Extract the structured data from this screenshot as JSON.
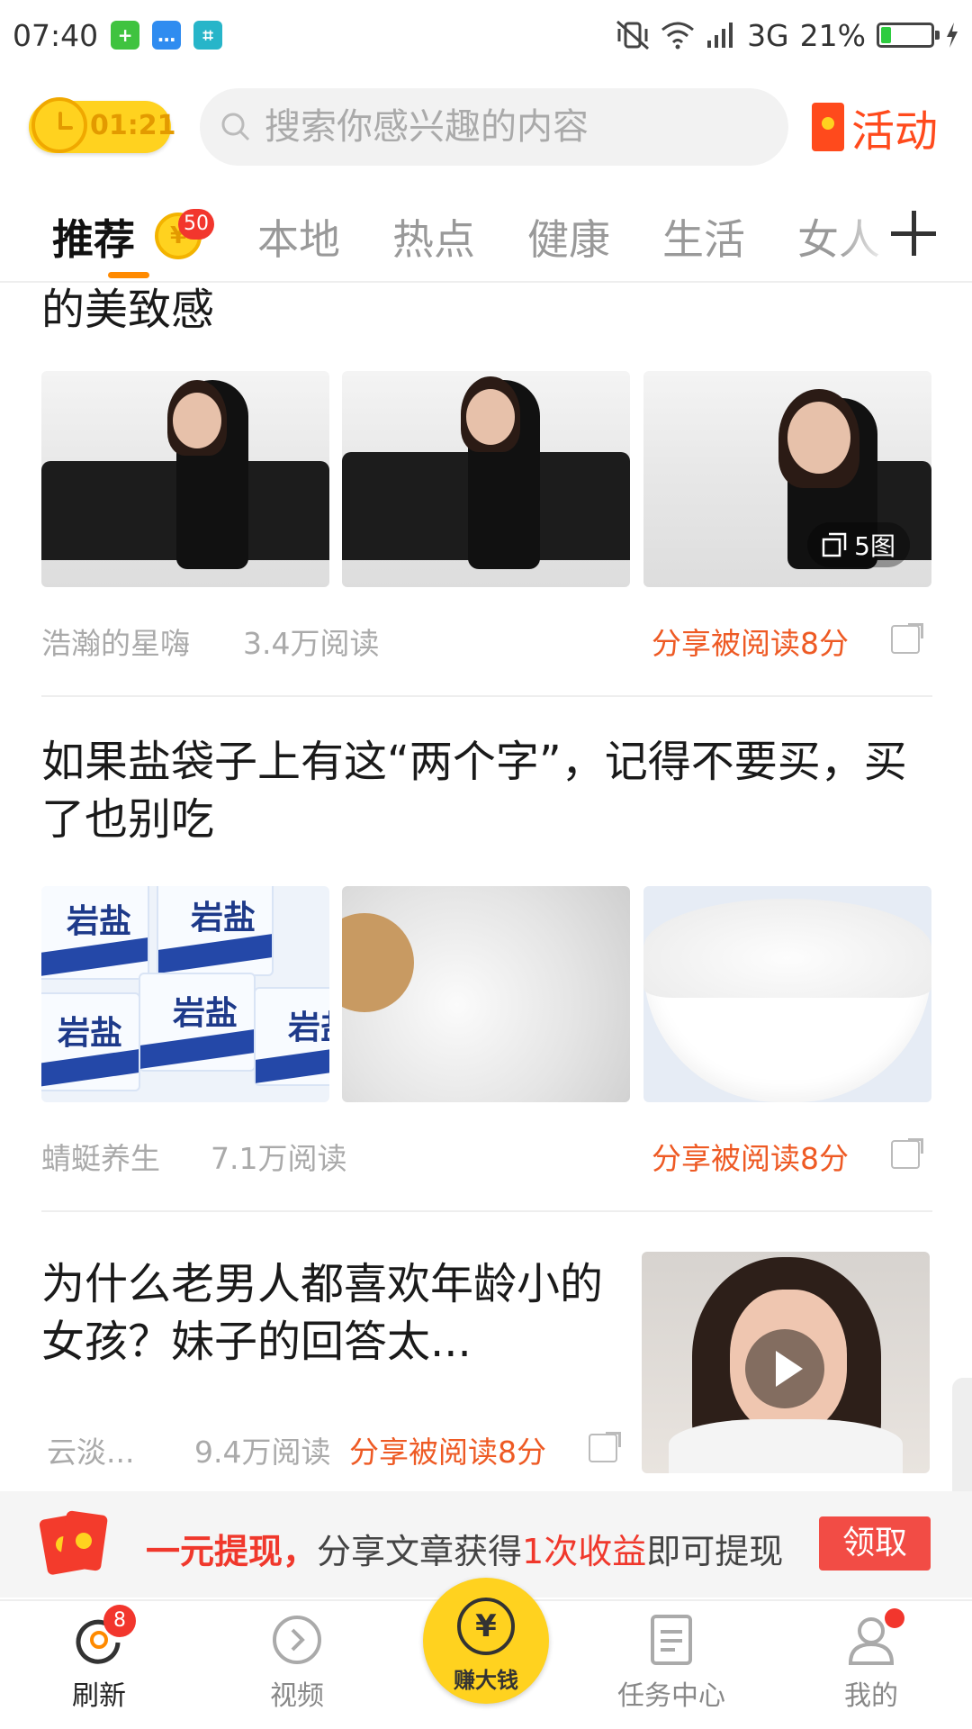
{
  "status_bar": {
    "time": "07:40",
    "network": "3G",
    "battery": "21%",
    "battery_level": 0.21,
    "icons": [
      "app-plus-icon",
      "message-icon",
      "scan-icon",
      "vibrate-icon",
      "wifi-icon",
      "signal-icon",
      "battery-icon"
    ]
  },
  "header": {
    "timer": "01:21",
    "search_placeholder": "搜索你感兴趣的内容",
    "activity_label": "活动"
  },
  "tabs": {
    "items": [
      "推荐",
      "本地",
      "热点",
      "健康",
      "生活",
      "女人"
    ],
    "active_index": 0,
    "coin_badge": "50",
    "coin_symbol": "¥"
  },
  "feed": {
    "articles": [
      {
        "title": "的美致感",
        "image_count": "5图",
        "author": "浩瀚的星嗨",
        "reads": "3.4万阅读",
        "share": "分享被阅读8分"
      },
      {
        "title": "如果盐袋子上有这“两个字”，记得不要买，买了也别吃",
        "package_text": "岩盐",
        "author": "蜻蜓养生",
        "reads": "7.1万阅读",
        "share": "分享被阅读8分"
      },
      {
        "title": "为什么老男人都喜欢年龄小的女孩？妹子的回答太...",
        "author": "云淡...",
        "reads": "9.4万阅读",
        "share": "分享被阅读8分"
      }
    ]
  },
  "promo": {
    "highlight": "一元提现，",
    "text1": "分享文章获得",
    "text2": "1次收益",
    "text3": "即可提现",
    "button": "领取"
  },
  "bottom_nav": {
    "refresh": "刷新",
    "refresh_badge": "8",
    "video": "视频",
    "earn": "赚大钱",
    "earn_symbol": "¥",
    "tasks": "任务中心",
    "mine": "我的"
  },
  "colors": {
    "accent_orange": "#ff8a00",
    "share_red": "#ee5a24",
    "brand_yellow": "#ffd21f",
    "badge_red": "#f2362d"
  }
}
